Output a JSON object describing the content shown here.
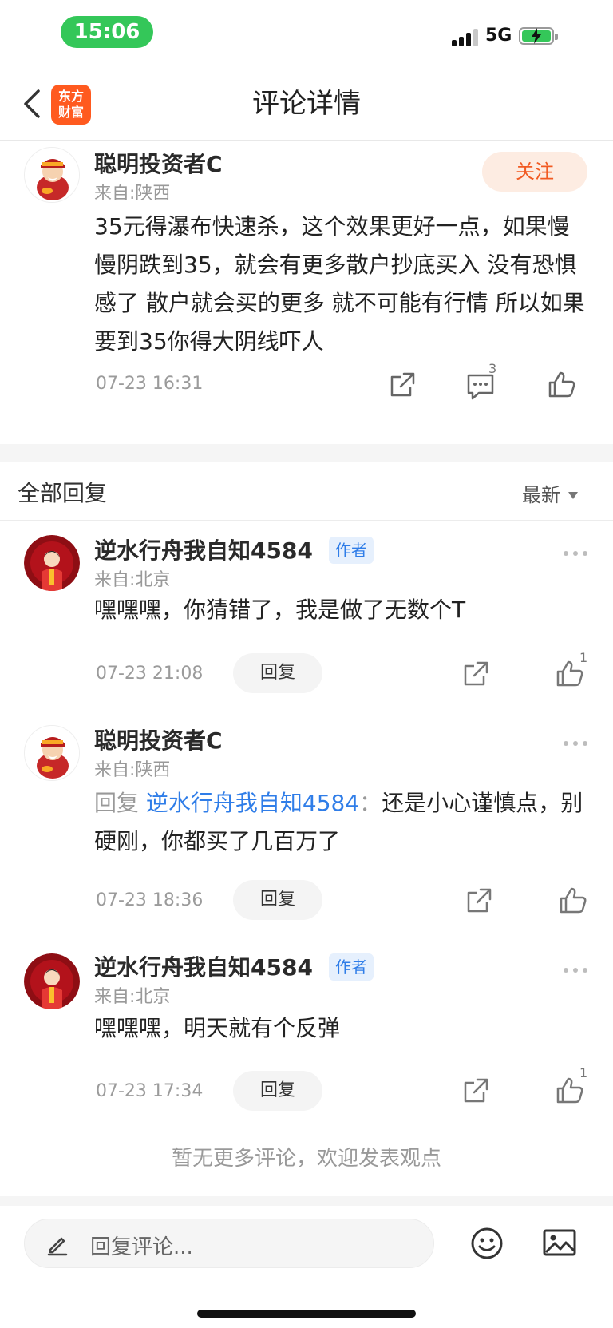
{
  "status_bar": {
    "time": "15:06",
    "network": "5G",
    "battery_charging": true,
    "accent_color": "#34c759"
  },
  "nav": {
    "title": "评论详情",
    "logo_text": "东方财富",
    "logo_color": "#ff5a1f"
  },
  "main_comment": {
    "username": "聪明投资者C",
    "location": "来自:陕西",
    "follow_label": "关注",
    "body": "35元得瀑布快速杀，这个效果更好一点，如果慢慢阴跌到35，就会有更多散户抄底买入 没有恐惧感了 散户就会买的更多 就不可能有行情 所以如果要到35你得大阴线吓人",
    "timestamp": "07-23 16:31",
    "comment_count": "3",
    "icons": [
      "share-icon",
      "comment-icon",
      "like-icon"
    ]
  },
  "replies_header": {
    "title": "全部回复",
    "sort_label": "最新"
  },
  "replies": [
    {
      "username": "逆水行舟我自知4584",
      "tag": "作者",
      "location": "来自:北京",
      "reply_prefix": "",
      "reply_target": "",
      "reply_sep": "",
      "text": "嘿嘿嘿，你猜错了，我是做了无数个T",
      "timestamp": "07-23 21:08",
      "reply_label": "回复",
      "like_count": "1"
    },
    {
      "username": "聪明投资者C",
      "tag": "",
      "location": "来自:陕西",
      "reply_prefix": "回复 ",
      "reply_target": "逆水行舟我自知4584",
      "reply_sep": "：",
      "text": "还是小心谨慎点，别硬刚，你都买了几百万了",
      "timestamp": "07-23 18:36",
      "reply_label": "回复",
      "like_count": ""
    },
    {
      "username": "逆水行舟我自知4584",
      "tag": "作者",
      "location": "来自:北京",
      "reply_prefix": "",
      "reply_target": "",
      "reply_sep": "",
      "text": "嘿嘿嘿，明天就有个反弹",
      "timestamp": "07-23 17:34",
      "reply_label": "回复",
      "like_count": "1"
    }
  ],
  "footer_note": "暂无更多评论，欢迎发表观点",
  "bottom_bar": {
    "input_placeholder": "回复评论...",
    "icons": [
      "pen-icon",
      "emoji-icon",
      "image-icon"
    ]
  }
}
